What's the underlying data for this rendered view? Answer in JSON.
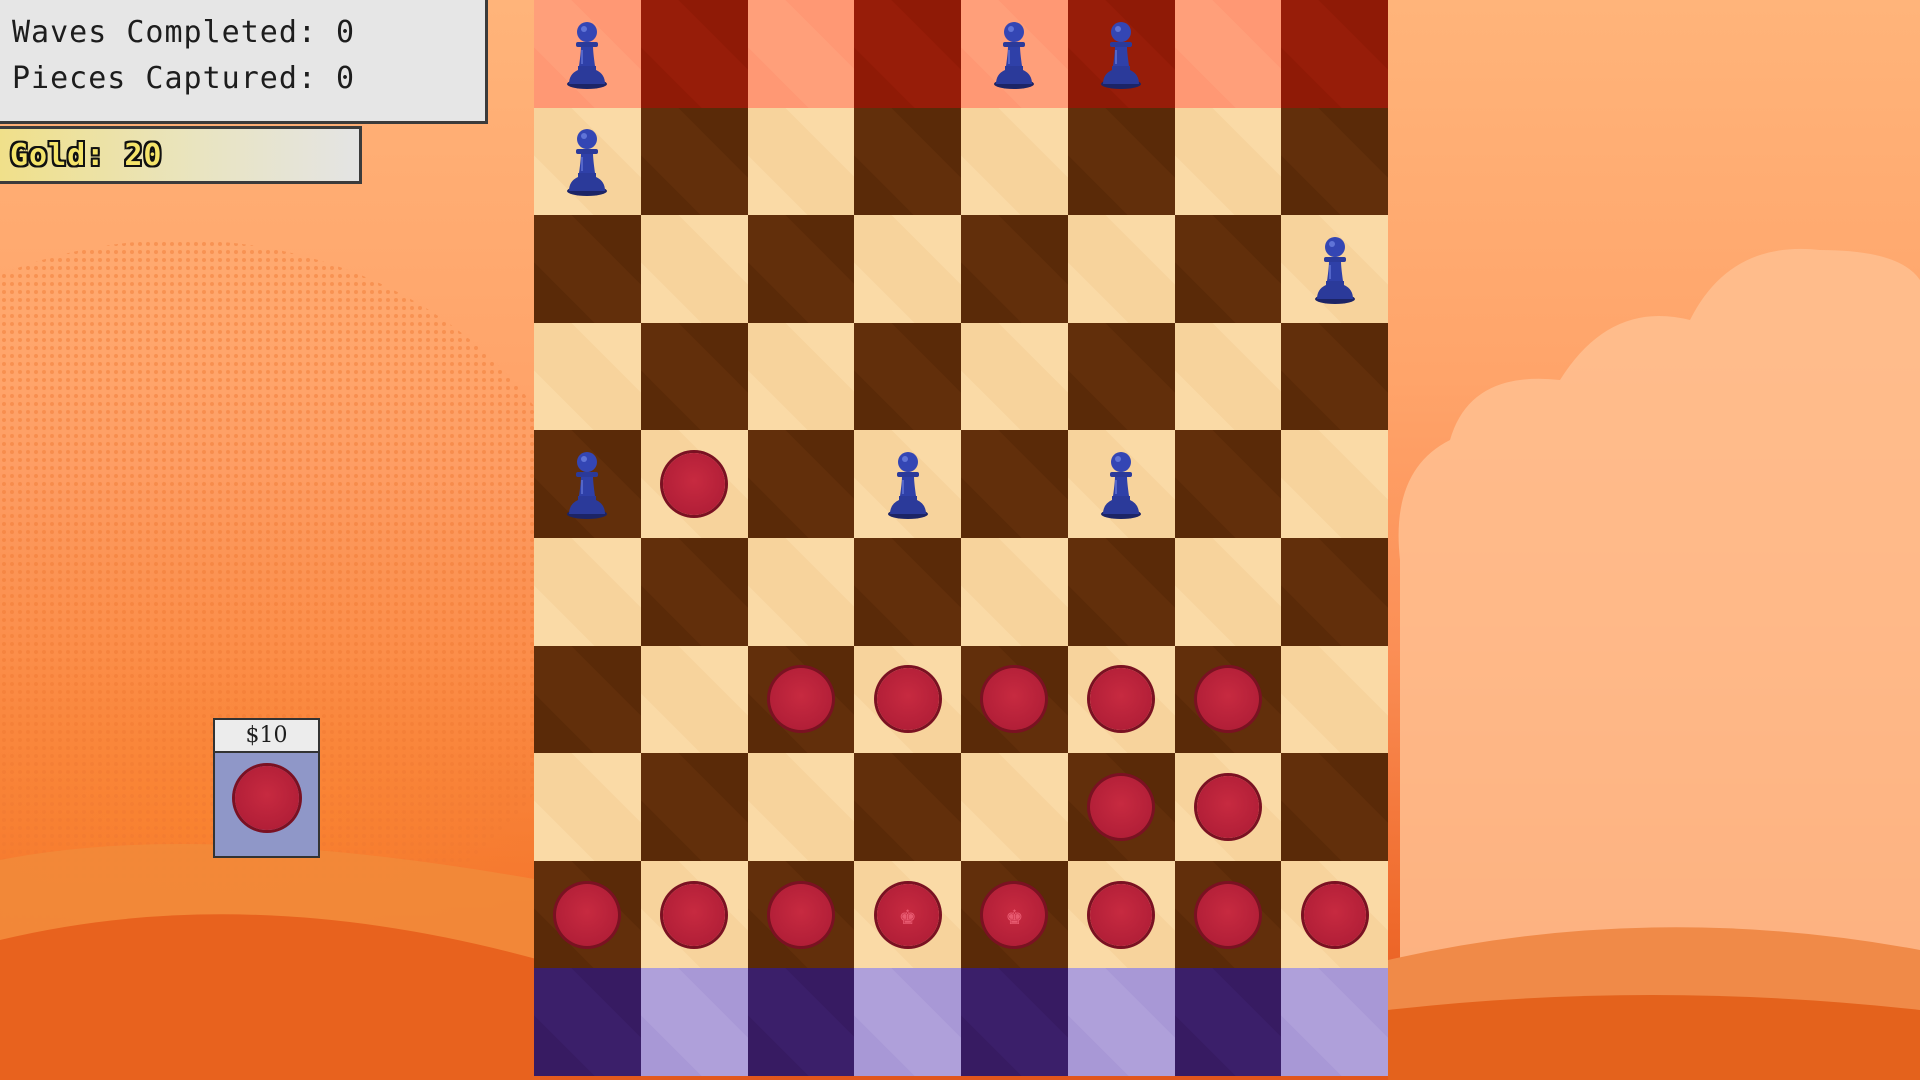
{
  "hud": {
    "waves_label": "Waves Completed: 0",
    "captured_label": "Pieces Captured: 0",
    "gold_label": "Gold: 20"
  },
  "shop": {
    "price": "$10",
    "item_icon": "red-checker-icon"
  },
  "colors": {
    "player": "#b31f38",
    "enemy": "#2b3a9a",
    "spawn_row_light": "#ff9874",
    "spawn_row_dark": "#8f1a06",
    "home_row_light": "#a898d6",
    "home_row_dark": "#371b62"
  },
  "board": {
    "columns": 8,
    "rows": 10,
    "pieces": [
      {
        "row": 0,
        "col": 0,
        "type": "pawn"
      },
      {
        "row": 0,
        "col": 4,
        "type": "pawn"
      },
      {
        "row": 0,
        "col": 5,
        "type": "pawn"
      },
      {
        "row": 1,
        "col": 0,
        "type": "pawn"
      },
      {
        "row": 2,
        "col": 7,
        "type": "pawn"
      },
      {
        "row": 4,
        "col": 0,
        "type": "pawn"
      },
      {
        "row": 4,
        "col": 1,
        "type": "checker"
      },
      {
        "row": 4,
        "col": 3,
        "type": "pawn"
      },
      {
        "row": 4,
        "col": 5,
        "type": "pawn"
      },
      {
        "row": 6,
        "col": 2,
        "type": "checker"
      },
      {
        "row": 6,
        "col": 3,
        "type": "checker"
      },
      {
        "row": 6,
        "col": 4,
        "type": "checker"
      },
      {
        "row": 6,
        "col": 5,
        "type": "checker"
      },
      {
        "row": 6,
        "col": 6,
        "type": "checker"
      },
      {
        "row": 7,
        "col": 5,
        "type": "checker"
      },
      {
        "row": 7,
        "col": 6,
        "type": "checker"
      },
      {
        "row": 8,
        "col": 0,
        "type": "checker"
      },
      {
        "row": 8,
        "col": 1,
        "type": "checker"
      },
      {
        "row": 8,
        "col": 2,
        "type": "checker"
      },
      {
        "row": 8,
        "col": 3,
        "type": "king"
      },
      {
        "row": 8,
        "col": 4,
        "type": "king"
      },
      {
        "row": 8,
        "col": 5,
        "type": "checker"
      },
      {
        "row": 8,
        "col": 6,
        "type": "checker"
      },
      {
        "row": 8,
        "col": 7,
        "type": "checker"
      }
    ]
  }
}
